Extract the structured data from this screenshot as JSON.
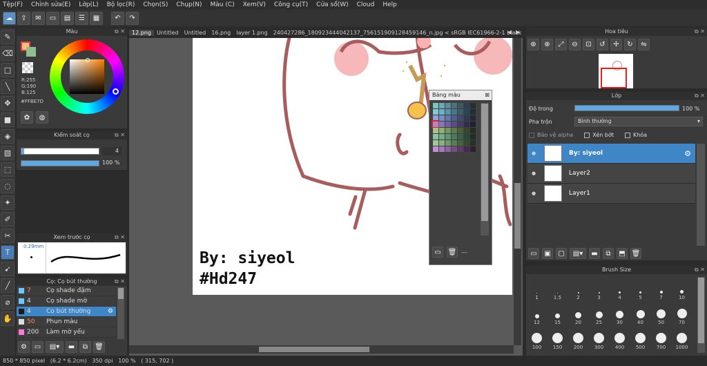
{
  "menu": [
    "Tệp(F)",
    "Chỉnh sửa(E)",
    "Lớp(L)",
    "Bộ lọc(R)",
    "Chọn(S)",
    "Chụp(N)",
    "Màu (C)",
    "Xem(V)",
    "Công cụ(T)",
    "Cửa sổ(W)",
    "Cloud",
    "Help"
  ],
  "panels": {
    "color_title": "Màu",
    "brush_control_title": "Kiểm soát cọ",
    "brush_preview_title": "Xem trước cọ",
    "brush_list_title": "Cọ: Cọ bút thường",
    "navigator_title": "Hoa tiêu",
    "layer_title": "Lớp",
    "brush_size_title": "Brush Size",
    "palette_title": "Bảng màu"
  },
  "color": {
    "r": "R:255",
    "g": "G:190",
    "b": "B:125",
    "hex": "#FFBE7D",
    "fg": "#FFBE7D",
    "bg": "#8fbf8f"
  },
  "brush_control": {
    "size": "4",
    "opacity": "100 %",
    "opacity_level": 100
  },
  "brush_preview": {
    "size_label": "0.29mm"
  },
  "brush_list": [
    {
      "size": "7",
      "name": "Cọ shade đậm",
      "color": "#6ec6ff",
      "selected": false
    },
    {
      "size": "4",
      "name": "Cọ shade mờ",
      "color": "#6ec6ff",
      "selected": false
    },
    {
      "size": "4",
      "name": "Cọ bút thường",
      "color": "#1a1a1a",
      "selected": true
    },
    {
      "size": "50",
      "name": "Phun màu",
      "color": "#dddddd",
      "selected": false
    },
    {
      "size": "200",
      "name": "Làm mờ yếu",
      "color": "#ff77dd",
      "selected": false
    }
  ],
  "tabs": [
    "12.png",
    "Untitled",
    "Untitled",
    "16.png",
    "layer 1.png",
    "240427286_180923444042137_7561519091284591​46_n.jpg < sRGB IEC61966-2-1 black scaled"
  ],
  "canvas_text": {
    "line1": "By: siyeol",
    "line2": "#Hd247"
  },
  "layer": {
    "opacity_label": "Độ trong",
    "opacity_value": "100 %",
    "opacity_level": 100,
    "blend_label": "Pha trộn",
    "blend_value": "Bình thường",
    "protect_alpha": "Bảo vệ alpha",
    "clip": "Xén bớt",
    "lock": "Khóa",
    "items": [
      {
        "name": "By: siyeol",
        "selected": true
      },
      {
        "name": "Layer2",
        "selected": false
      },
      {
        "name": "Layer1",
        "selected": false
      }
    ]
  },
  "brush_sizes": {
    "row1": [
      "1",
      "1.5",
      "2",
      "3",
      "4",
      "5",
      "7",
      "10"
    ],
    "row2": [
      "12",
      "15",
      "20",
      "25",
      "30",
      "40",
      "50",
      "70"
    ],
    "row3": [
      "100",
      "150",
      "200",
      "300",
      "400",
      "500",
      "700",
      "1000"
    ]
  },
  "palette_footer": "---",
  "status": {
    "size": "850 * 850 pixel",
    "cm": "(6.2 * 6.2cm)",
    "dpi": "350 dpi",
    "zoom": "100 %",
    "coords": "( 315, 702 )"
  }
}
